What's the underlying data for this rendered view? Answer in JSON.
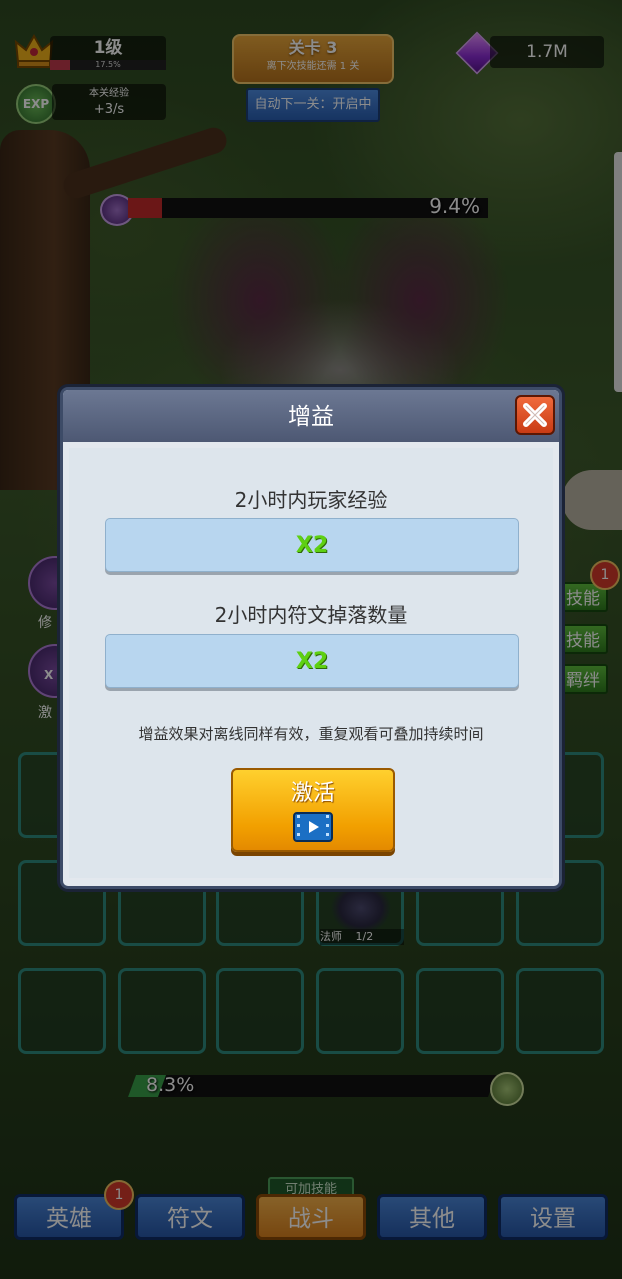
{
  "hud": {
    "level": "1级",
    "level_progress_text": "17.5%",
    "level_progress": 0.175,
    "exp_icon_text": "EXP",
    "exp_label": "本关经验",
    "exp_rate": "+3/s",
    "stage_title": "关卡 3",
    "stage_sub": "离下次技能还需 1 关",
    "auto_next": "自动下一关：开启中",
    "gems": "1.7M"
  },
  "boss": {
    "hp_text": "9.4%",
    "hp": 0.094
  },
  "side": {
    "left_labels": [
      "修",
      "激"
    ],
    "left_x_text": "X",
    "right_buttons": [
      "技能",
      "技能",
      "羁绊"
    ],
    "badge": "1"
  },
  "grid": {
    "hero_label": "法师",
    "hero_count": "1/2"
  },
  "progress": {
    "text": "8.3%",
    "value": 0.083
  },
  "nav": {
    "items": [
      "英雄",
      "符文",
      "战斗",
      "其他",
      "设置"
    ],
    "badge": "1",
    "tag": "可加技能"
  },
  "modal": {
    "title": "增益",
    "buff1_label": "2小时内玩家经验",
    "buff1_value": "X2",
    "buff2_label": "2小时内符文掉落数量",
    "buff2_value": "X2",
    "note": "增益效果对离线同样有效，重复观看可叠加持续时间",
    "activate": "激活"
  },
  "icons": [
    "crown-icon",
    "exp-icon",
    "gem-icon",
    "close-icon",
    "video-play-icon",
    "boss-skull-icon"
  ],
  "colors": {
    "accent_green": "#5ed012",
    "hp_red": "#c32b2b",
    "nav_blue": "#2858a8",
    "nav_active": "#f2a000"
  }
}
